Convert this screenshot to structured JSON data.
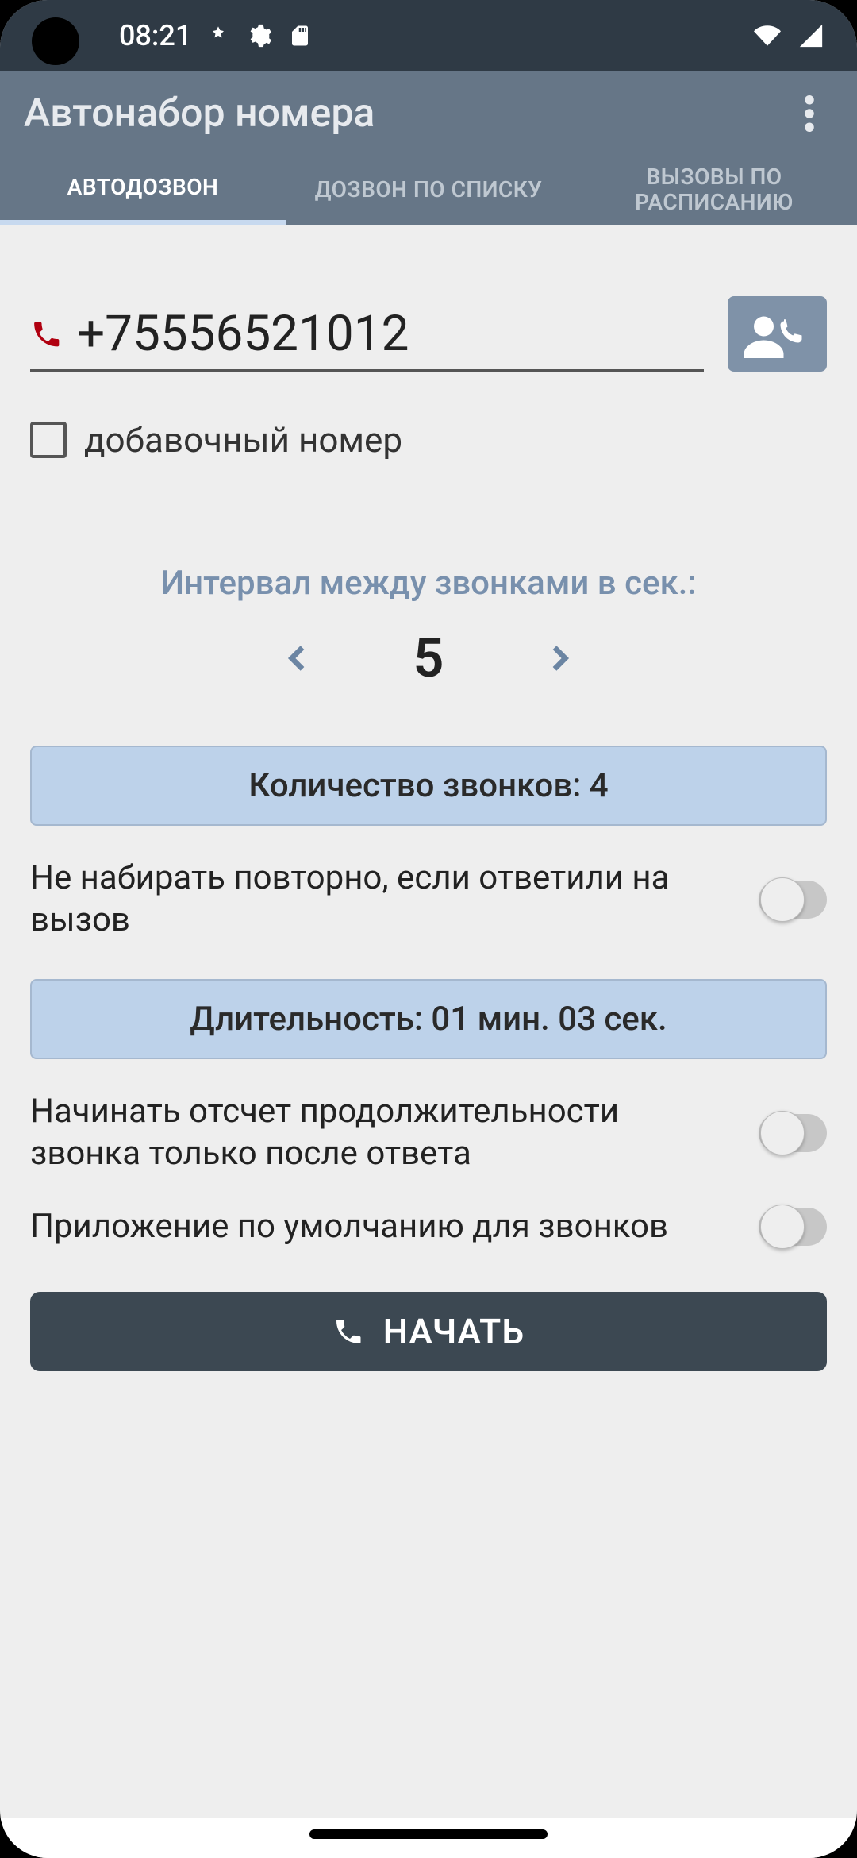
{
  "status": {
    "time": "08:21"
  },
  "appbar": {
    "title": "Автонабор номера"
  },
  "tabs": {
    "t0": "АВТОДОЗВОН",
    "t1": "ДОЗВОН ПО СПИСКУ",
    "t2": "ВЫЗОВЫ ПО РАСПИСАНИЮ"
  },
  "phone": {
    "value": "+75556521012"
  },
  "ext": {
    "label": "добавочный номер"
  },
  "interval": {
    "label": "Интервал между звонками в сек.:",
    "value": "5"
  },
  "calls_chip": "Количество звонков:  4",
  "duration_chip": "Длительность: 01 мин. 03 сек.",
  "settings": {
    "no_redial": "Не набирать повторно, если ответили на вызов",
    "start_after_answer": "Начинать отсчет продолжительности звонка только после ответа",
    "default_app": "Приложение по умолчанию для звонков"
  },
  "start_btn": "НАЧАТЬ"
}
